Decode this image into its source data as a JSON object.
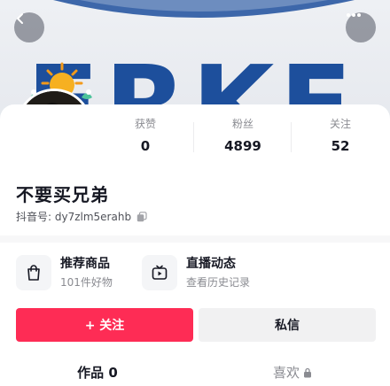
{
  "header": {
    "back_icon": "chevron-left-icon",
    "more_icon": "more-horizontal-icon",
    "cover_text": "ERKE"
  },
  "profile": {
    "nickname": "不要买兄弟",
    "douyin_id": "抖音号: dy7zlm5erahb",
    "copy_icon": "copy-icon"
  },
  "stats": [
    {
      "label": "获赞",
      "value": "0"
    },
    {
      "label": "粉丝",
      "value": "4899"
    },
    {
      "label": "关注",
      "value": "52"
    }
  ],
  "entries": [
    {
      "title": "推荐商品",
      "subtitle": "101件好物",
      "icon": "shopping-bag-icon"
    },
    {
      "title": "直播动态",
      "subtitle": "查看历史记录",
      "icon": "live-tv-icon"
    }
  ],
  "actions": {
    "follow_label": "+ 关注",
    "message_label": "私信"
  },
  "tabs": {
    "works_label": "作品 0",
    "likes_label": "喜欢",
    "likes_icon": "lock-icon"
  },
  "colors": {
    "accent": "#fe2c55",
    "cover_logo": "#1d4f9c"
  }
}
